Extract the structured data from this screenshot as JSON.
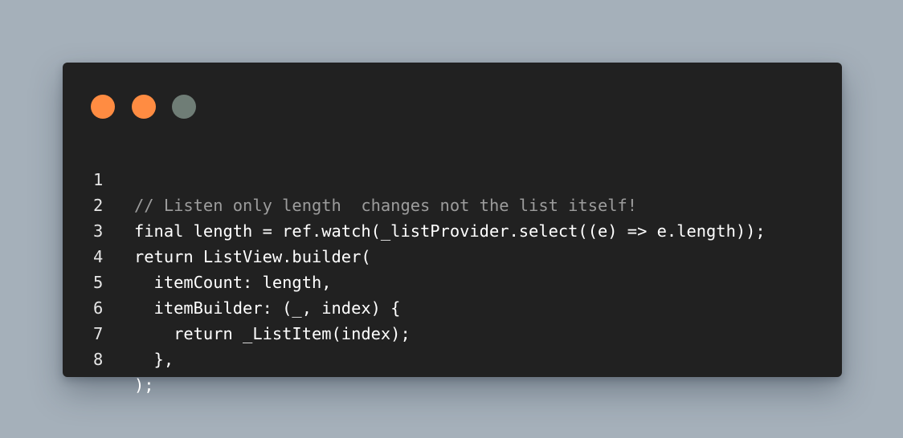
{
  "colors": {
    "background": "#a5b0ba",
    "window": "#212121",
    "dot_close": "#ff8c42",
    "dot_minimize": "#ff8c42",
    "dot_zoom": "#6f7d76",
    "line_number": "#e6e6e6",
    "code_text": "#ffffff",
    "comment": "#9c9c9c"
  },
  "window_controls": [
    {
      "name": "close-dot",
      "color": "#ff8c42"
    },
    {
      "name": "minimize-dot",
      "color": "#ff8c42"
    },
    {
      "name": "zoom-dot",
      "color": "#6f7d76"
    }
  ],
  "code": {
    "lines": [
      {
        "number": "1",
        "text": "// Listen only length  changes not the list itself!",
        "is_comment": true
      },
      {
        "number": "2",
        "text": "final length = ref.watch(_listProvider.select((e) => e.length));",
        "is_comment": false
      },
      {
        "number": "3",
        "text": "return ListView.builder(",
        "is_comment": false
      },
      {
        "number": "4",
        "text": "  itemCount: length,",
        "is_comment": false
      },
      {
        "number": "5",
        "text": "  itemBuilder: (_, index) {",
        "is_comment": false
      },
      {
        "number": "6",
        "text": "    return _ListItem(index);",
        "is_comment": false
      },
      {
        "number": "7",
        "text": "  },",
        "is_comment": false
      },
      {
        "number": "8",
        "text": ");",
        "is_comment": false
      }
    ]
  }
}
